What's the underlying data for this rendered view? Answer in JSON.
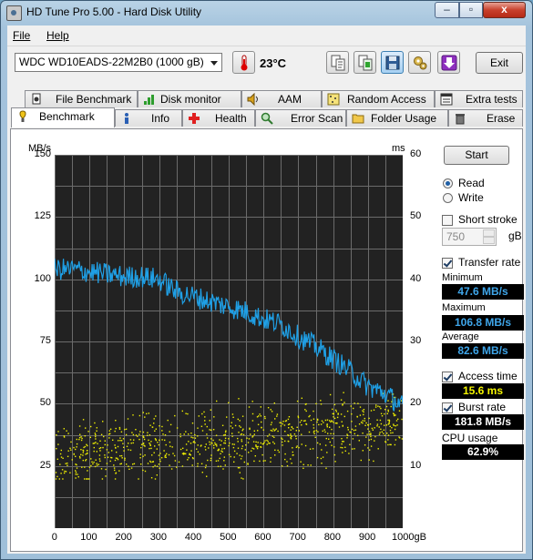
{
  "window": {
    "title": "HD Tune Pro 5.00 - Hard Disk Utility",
    "min": "–",
    "max": "▫",
    "close": "x"
  },
  "menu": {
    "file": "File",
    "help": "Help"
  },
  "toolbar": {
    "drive": "WDC WD10EADS-22M2B0 (1000 gB)",
    "temperature": "23°C",
    "exit_label": "Exit",
    "icons": [
      "copy-text-icon",
      "copy-screenshot-icon",
      "save-icon",
      "options-icon",
      "down-arrow-icon"
    ]
  },
  "tabs_top": [
    "File Benchmark",
    "Disk monitor",
    "AAM",
    "Random Access",
    "Extra tests"
  ],
  "tabs_bottom": [
    "Benchmark",
    "Info",
    "Health",
    "Error Scan",
    "Folder Usage",
    "Erase"
  ],
  "colors": {
    "transfer": "#1fa0e6",
    "access": "#f0f000",
    "plot_bg": "#222222",
    "grid": "#6b6b6b"
  },
  "chart_data": {
    "type": "line",
    "left_axis_unit": "MB/s",
    "right_axis_unit": "ms",
    "x_ticks": [
      "0",
      "100",
      "200",
      "300",
      "400",
      "500",
      "600",
      "700",
      "800",
      "900",
      "1000gB"
    ],
    "y_ticks_left": [
      "150",
      "125",
      "100",
      "75",
      "50",
      "25"
    ],
    "y_ticks_right": [
      "60",
      "50",
      "40",
      "30",
      "20",
      "10"
    ],
    "xlim": [
      0,
      1000
    ],
    "ylim_left": [
      0,
      150
    ],
    "ylim_right": [
      0,
      60
    ],
    "grid": true,
    "series": [
      {
        "name": "Transfer rate",
        "axis": "left",
        "x": [
          0,
          50,
          100,
          150,
          200,
          250,
          300,
          350,
          400,
          450,
          500,
          550,
          600,
          650,
          700,
          750,
          800,
          850,
          900,
          950,
          1000
        ],
        "values": [
          104,
          104,
          103,
          102,
          101,
          101,
          100,
          95,
          93,
          91,
          89,
          87,
          84,
          82,
          77,
          73,
          68,
          63,
          57,
          54,
          49
        ]
      },
      {
        "name": "Access time",
        "axis": "right",
        "type": "scatter",
        "x_range": [
          0,
          1000
        ],
        "y_range_ms": [
          8,
          24
        ],
        "note_level": "access time rises roughly from 12 ms to 17 ms across the disk"
      }
    ]
  },
  "panel": {
    "start_label": "Start",
    "read_label": "Read",
    "write_label": "Write",
    "short_stroke_label": "Short stroke",
    "short_stroke_value": "750",
    "short_stroke_unit": "gB",
    "transfer_rate_label": "Transfer rate",
    "minimum_label": "Minimum",
    "minimum_value": "47.6 MB/s",
    "maximum_label": "Maximum",
    "maximum_value": "106.8 MB/s",
    "average_label": "Average",
    "average_value": "82.6 MB/s",
    "access_time_label": "Access time",
    "access_time_value": "15.6 ms",
    "burst_rate_label": "Burst rate",
    "burst_rate_value": "181.8 MB/s",
    "cpu_usage_label": "CPU usage",
    "cpu_usage_value": "62.9%"
  }
}
